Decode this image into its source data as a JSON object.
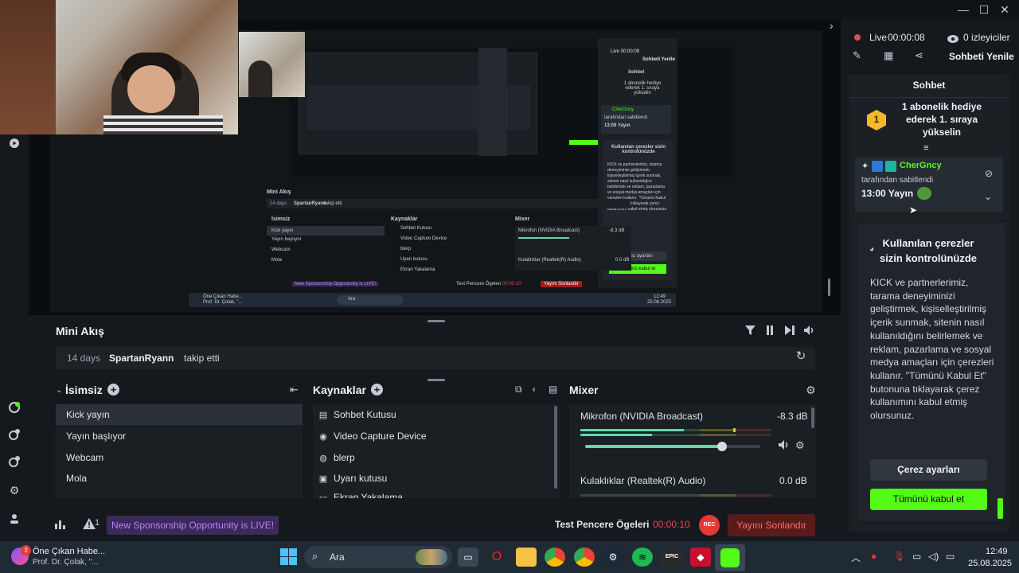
{
  "window": {
    "minimize": "—",
    "maximize": "☐",
    "close": "✕"
  },
  "mini_akis": {
    "title": "Mini Akış",
    "event": {
      "time": "14 days",
      "user": "SpartanRyann",
      "action": "takip etti"
    }
  },
  "scenes": {
    "title": "İsimsiz",
    "items": [
      "Kick yayın",
      "Yayın başlıyor",
      "Webcam",
      "Mola"
    ]
  },
  "sources": {
    "title": "Kaynaklar",
    "items": [
      {
        "label": "Sohbet Kutusu",
        "icon": "chat-box-icon"
      },
      {
        "label": "Video Capture Device",
        "icon": "camera-icon"
      },
      {
        "label": "blerp",
        "icon": "globe-icon"
      },
      {
        "label": "Uyarı kutusu",
        "icon": "alert-box-icon"
      },
      {
        "label": "Ekran Yakalama",
        "icon": "screen-capture-icon"
      }
    ]
  },
  "mixer": {
    "title": "Mixer",
    "channels": [
      {
        "name": "Mikrofon (NVIDIA Broadcast)",
        "level": "-8.3 dB",
        "meter_fill": 0.5,
        "volume": 0.78
      },
      {
        "name": "Kulaklıklar (Realtek(R) Audio)",
        "level": "0.0 dB"
      }
    ]
  },
  "status": {
    "alert_count": "1",
    "sponsorship": "New Sponsorship Opportunity is LIVE!",
    "test_label": "Test Pencere Ögeleri",
    "rec_time": "00:00:10",
    "rec_badge": "REC",
    "end_stream": "Yayını Sonlandır"
  },
  "right_panel": {
    "live_label": "Live",
    "live_time": "00:00:08",
    "viewers": "0 izleyiciler",
    "refresh_chat": "Sohbeti Yenile",
    "chat_title": "Sohbet",
    "goal_rank": "1",
    "goal_text": "1 abonelik hediye ederek 1. sıraya yükselin",
    "pinned_user": "CherGncy",
    "pinned_by": "tarafından sabitlendi",
    "pinned_message": "13:00 Yayın"
  },
  "cookie": {
    "title": "Kullanılan çerezler sizin kontrolünüzde",
    "body": "KICK ve partnerlerimiz, tarama deneyiminizi geliştirmek, kişiselleştirilmiş içerik sunmak, sitenin nasıl kullanıldığını belirlemek ve reklam, pazarlama ve sosyal medya amaçları için çerezleri kullanır. \"Tümünü Kabul Et\" butonuna tıklayarak çerez kullanımını kabul etmiş olursunuz.",
    "settings_button": "Çerez ayarları",
    "accept_button": "Tümünü kabul et"
  },
  "nested_preview": {
    "mini_akis": "Mini Akış",
    "days": "14 days",
    "user": "SpartanRyann",
    "action": "takip etti",
    "scenes_title": "İsimsiz",
    "scenes": [
      "Kick yayın",
      "Yayın başlıyor",
      "Webcam",
      "Mola"
    ],
    "sources_title": "Kaynaklar",
    "sources": [
      "Sohbet Kutusu",
      "Video Capture Device",
      "blerp",
      "Uyarı kutusu",
      "Ekran Yakalama"
    ],
    "mixer_title": "Mixer",
    "mic": "Mikrofon (NVIDIA Broadcast)",
    "mic_db": "-8.3 dB",
    "headset": "Kulaklıklar (Realtek(R) Audio)",
    "headset_db": "0.0 dB",
    "sponsorship": "New Sponsorship Opportunity is LIVE!",
    "test_label": "Test Pencere Ögeleri",
    "rec_time": "00:00:10",
    "end_stream": "Yayını Sonlandır",
    "live": "Live 00:00:08",
    "refresh": "Sohbeti Yenile",
    "chat": "Sohbet",
    "goal": "1 abonelik hediye ederek 1. sıraya yükselin",
    "pinned_user": "CherGncy",
    "pinned_by": "tarafından sabitlendi",
    "pinned_msg": "13:00 Yayın",
    "cookie_title": "Kullanılan çerezler sizin kontrolünüzde",
    "cookie_body": "KICK ve partnerlerimiz, tarama deneyiminizi geliştirmek, kişiselleştirilmiş içerik sunmak, sitenin nasıl kullanıldığını belirlemek ve reklam, pazarlama ve sosyal medya amaçları için çerezleri kullanır. \"Tümünü Kabul Et\" butonuna tıklayarak çerez kullanımını kabul etmiş olursunuz.",
    "cookie_settings": "Çerez ayarları",
    "cookie_accept": "Tümünü kabul et",
    "news_title": "Öne Çıkan Habe...",
    "news_sub": "Prof. Dr. Çolak, \"...",
    "search": "Ara",
    "clock": "12:49",
    "date": "25.08.2025"
  },
  "taskbar": {
    "news_badge": "3",
    "news_title": "Öne Çıkan Habe...",
    "news_sub": "Prof. Dr. Çolak, \"...",
    "search": "Ara",
    "clock": "12:49",
    "date": "25.08.2025",
    "apps": [
      "task-view",
      "opera",
      "file-explorer",
      "chrome-alt",
      "chrome",
      "steam",
      "spotify",
      "epic-games",
      "game-app",
      "kick-studio"
    ]
  },
  "colors": {
    "accent_green": "#53fc18",
    "live_red": "#e5484d",
    "sponsor_purple": "#b981ff",
    "rec_red": "#e53935"
  }
}
